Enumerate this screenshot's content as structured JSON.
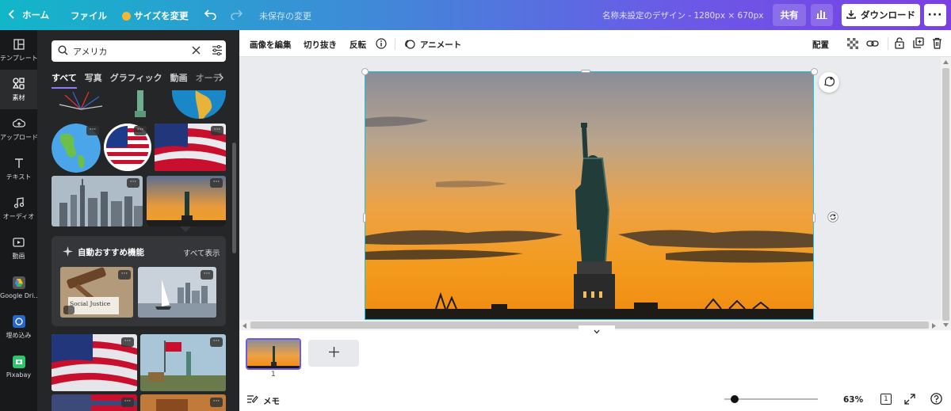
{
  "topbar": {
    "home": "ホーム",
    "file": "ファイル",
    "resize": "サイズを変更",
    "unsaved": "未保存の変更",
    "title": "名称未設定のデザイン - 1280px × 670px",
    "share": "共有",
    "download": "ダウンロード"
  },
  "rail": {
    "items": [
      {
        "label": "テンプレート",
        "icon": "template-icon"
      },
      {
        "label": "素材",
        "icon": "elements-icon"
      },
      {
        "label": "アップロード",
        "icon": "upload-icon"
      },
      {
        "label": "テキスト",
        "icon": "text-icon"
      },
      {
        "label": "オーディオ",
        "icon": "audio-icon"
      },
      {
        "label": "動画",
        "icon": "video-icon"
      },
      {
        "label": "Google Dri...",
        "icon": "google-drive-icon"
      },
      {
        "label": "埋め込み",
        "icon": "embed-icon"
      },
      {
        "label": "Pixabay",
        "icon": "pixabay-icon"
      }
    ]
  },
  "panel": {
    "search_value": "アメリカ",
    "tabs": [
      "すべて",
      "写真",
      "グラフィック",
      "動画",
      "オーデ"
    ],
    "recommend_title": "自動おすすめ機能",
    "show_all": "すべて表示",
    "social_justice": "Social Justice"
  },
  "editor": {
    "edit_image": "画像を編集",
    "crop": "切り抜き",
    "flip": "反転",
    "animate": "アニメート",
    "position": "配置"
  },
  "pages": {
    "page_number": "1"
  },
  "bottom": {
    "notes": "メモ",
    "zoom": "63%",
    "page_count": "1"
  },
  "colors": {
    "accent_cyan": "#18c4d6",
    "purple": "#7b3fe4",
    "panel_bg": "#252627"
  }
}
